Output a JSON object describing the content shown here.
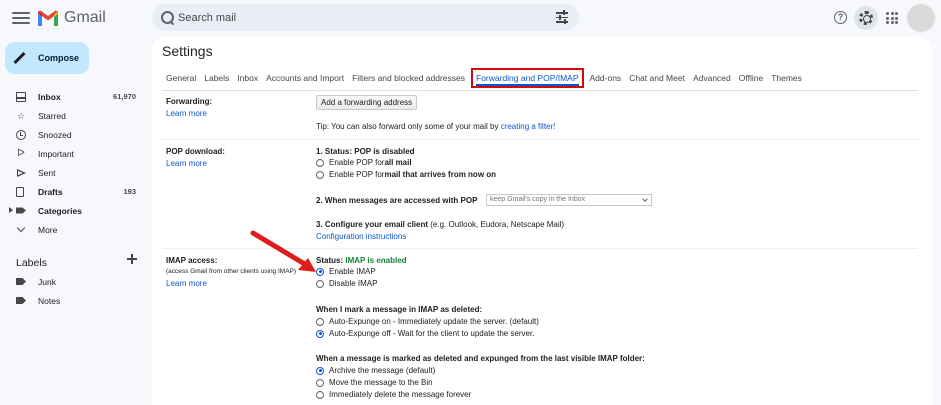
{
  "app": {
    "name": "Gmail",
    "search_placeholder": "Search mail"
  },
  "sidebar": {
    "compose_label": "Compose",
    "items": [
      {
        "label": "Inbox",
        "count": "61,970",
        "icon": "inbox-icon",
        "bold": true
      },
      {
        "label": "Starred",
        "count": "",
        "icon": "star-icon"
      },
      {
        "label": "Snoozed",
        "count": "",
        "icon": "clock-icon"
      },
      {
        "label": "Important",
        "count": "",
        "icon": "important-icon"
      },
      {
        "label": "Sent",
        "count": "",
        "icon": "send-icon"
      },
      {
        "label": "Drafts",
        "count": "193",
        "icon": "file-icon",
        "bold": true
      },
      {
        "label": "Categories",
        "count": "",
        "icon": "tag-icon",
        "bold": true
      },
      {
        "label": "More",
        "count": "",
        "icon": "chevron-down-icon"
      }
    ],
    "labels_heading": "Labels",
    "labels": [
      "Junk",
      "Notes"
    ]
  },
  "settings": {
    "title": "Settings",
    "tabs": [
      "General",
      "Labels",
      "Inbox",
      "Accounts and Import",
      "Filters and blocked addresses",
      "Forwarding and POP/IMAP",
      "Add-ons",
      "Chat and Meet",
      "Advanced",
      "Offline",
      "Themes"
    ],
    "active_tab": "Forwarding and POP/IMAP",
    "forwarding": {
      "label": "Forwarding:",
      "learn_more": "Learn more",
      "add_button": "Add a forwarding address",
      "tip_prefix": "Tip: You can also forward only some of your mail by ",
      "tip_link": "creating a filter!"
    },
    "pop": {
      "label": "POP download:",
      "learn_more": "Learn more",
      "status": "1. Status: POP is disabled",
      "opt1_prefix": "Enable POP for ",
      "opt1_bold": "all mail",
      "opt2_prefix": "Enable POP for ",
      "opt2_bold": "mail that arrives from now on",
      "q2": "2. When messages are accessed with POP",
      "q2_select": "keep Gmail's copy in the Inbox",
      "q3_bold": "3. Configure your email client",
      "q3_rest": " (e.g. Outlook, Eudora, Netscape Mail)",
      "config_link": "Configuration instructions"
    },
    "imap": {
      "label": "IMAP access:",
      "sublabel": "(access Gmail from other clients using IMAP)",
      "learn_more": "Learn more",
      "status_prefix": "Status: ",
      "status_value": "IMAP is enabled",
      "enable": "Enable IMAP",
      "disable": "Disable IMAP",
      "deleted_heading": "When I mark a message in IMAP as deleted:",
      "expunge_on": "Auto-Expunge on - Immediately update the server. (default)",
      "expunge_off": "Auto-Expunge off - Wait for the client to update the server.",
      "expunged_heading": "When a message is marked as deleted and expunged from the last visible IMAP folder:",
      "archive": "Archive the message (default)",
      "bin": "Move the message to the Bin",
      "delete_forever": "Immediately delete the message forever"
    }
  },
  "colors": {
    "accent": "#0b57d0",
    "highlight_box": "#d20a0a",
    "arrow": "#e01b1b",
    "status_green": "#188038"
  }
}
